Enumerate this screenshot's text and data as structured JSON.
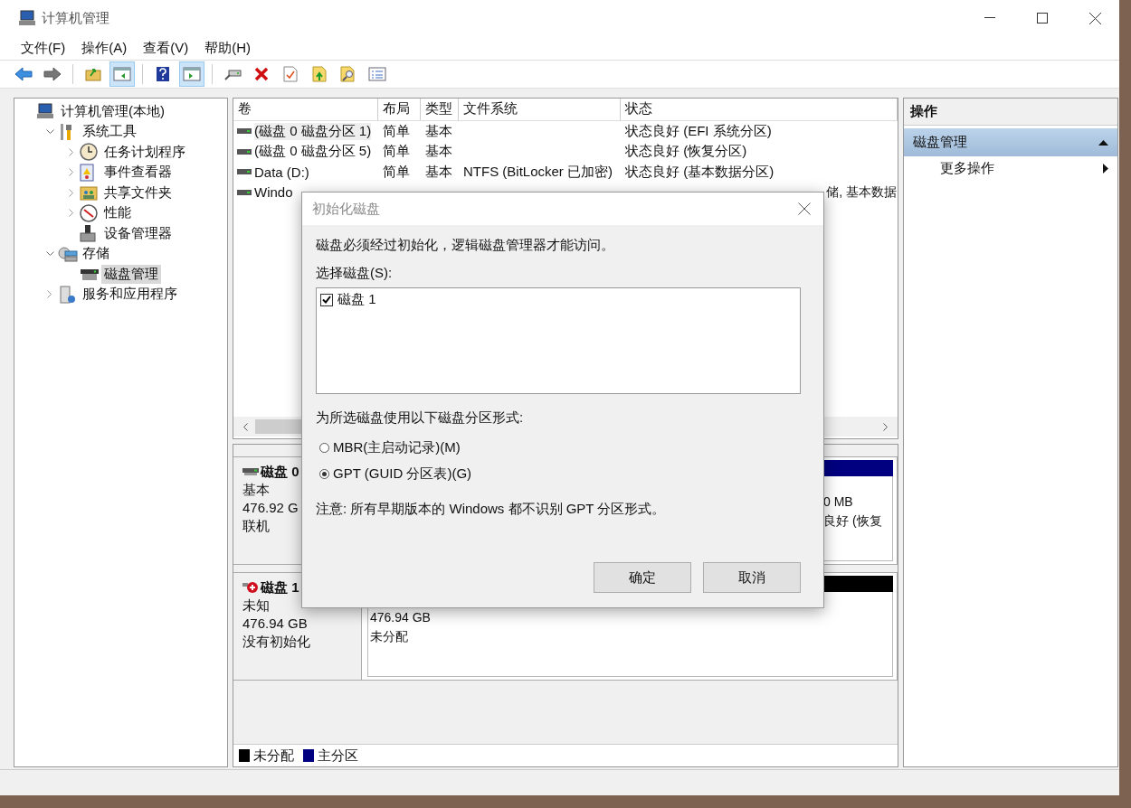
{
  "window": {
    "title": "计算机管理"
  },
  "menu": [
    "文件(F)",
    "操作(A)",
    "查看(V)",
    "帮助(H)"
  ],
  "toolbar": [
    [
      {
        "on": false
      },
      {
        "on": false
      }
    ],
    [
      {
        "on": false
      },
      {
        "on": true
      }
    ],
    [
      {
        "on": false
      },
      {
        "on": true
      }
    ],
    [
      {
        "on": false
      },
      {
        "on": false
      },
      {
        "on": false
      },
      {
        "on": false
      },
      {
        "on": false
      },
      {
        "on": false
      }
    ]
  ],
  "tree": [
    {
      "label": "计算机管理(本地)",
      "selected": false,
      "children": [
        {
          "label": "系统工具",
          "kind": "branch",
          "expanded": true,
          "selected": false,
          "children": [
            {
              "label": "任务计划程序",
              "kind": "branch",
              "expanded": false,
              "selected": false
            },
            {
              "label": "事件查看器",
              "kind": "branch",
              "expanded": false,
              "selected": false
            },
            {
              "label": "共享文件夹",
              "kind": "branch",
              "expanded": false,
              "selected": false
            },
            {
              "label": "性能",
              "kind": "branch",
              "expanded": false,
              "selected": false
            },
            {
              "label": "设备管理器",
              "kind": "leaf",
              "selected": false
            }
          ]
        },
        {
          "label": "存储",
          "kind": "branch",
          "expanded": true,
          "selected": false,
          "children": [
            {
              "label": "磁盘管理",
              "kind": "leaf",
              "selected": true
            }
          ]
        },
        {
          "label": "服务和应用程序",
          "kind": "branch",
          "expanded": false,
          "selected": false
        }
      ]
    }
  ],
  "volumes": {
    "columns": [
      "卷",
      "布局",
      "类型",
      "文件系统",
      "状态"
    ],
    "rows": [
      {
        "volume": "(磁盘 0 磁盘分区 1)",
        "layout": "简单",
        "type": "基本",
        "status": "状态良好 (EFI 系统分区)",
        "selected": true
      },
      {
        "volume": "(磁盘 0 磁盘分区 5)",
        "layout": "简单",
        "type": "基本",
        "status": "状态良好 (恢复分区)",
        "selected": false
      },
      {
        "volume": "Data (D:)",
        "layout": "简单",
        "type": "基本",
        "file_system": "NTFS (BitLocker 已加密)",
        "status": "状态良好 (基本数据分区)",
        "selected": false
      },
      {
        "volume": "Windo",
        "status": "储, 基本数据",
        "selected": false
      }
    ]
  },
  "disks": [
    {
      "name": "磁盘 0",
      "kind": "online",
      "lines": [
        "基本",
        "476.92 G",
        "联机"
      ],
      "partitions": [
        {
          "color": "#000080",
          "lines": [
            "0 MB",
            "良好 (恢复"
          ]
        }
      ]
    },
    {
      "name": "磁盘 1",
      "kind": "error",
      "lines": [
        "未知",
        "476.94 GB",
        "没有初始化"
      ],
      "partitions": [
        {
          "color": "#000000",
          "lines": [
            "476.94 GB",
            "未分配"
          ]
        }
      ]
    }
  ],
  "legend": [
    {
      "label": "未分配",
      "color": "#000000"
    },
    {
      "label": "主分区",
      "color": "#000080"
    }
  ],
  "actions": {
    "title": "操作",
    "items": [
      {
        "label": "磁盘管理",
        "kind": "section",
        "expanded": true
      },
      {
        "label": "更多操作",
        "kind": "submenu"
      }
    ]
  },
  "dialog": {
    "title": "初始化磁盘",
    "message": "磁盘必须经过初始化，逻辑磁盘管理器才能访问。",
    "select_label": "选择磁盘(S):",
    "disks": [
      {
        "label": "磁盘 1",
        "checked": true
      }
    ],
    "style_label": "为所选磁盘使用以下磁盘分区形式:",
    "options": [
      {
        "label": "MBR(主启动记录)(M)",
        "selected": false
      },
      {
        "label": "GPT (GUID 分区表)(G)",
        "selected": true
      }
    ],
    "note": "注意: 所有早期版本的 Windows 都不识别 GPT 分区形式。",
    "buttons": [
      "确定",
      "取消"
    ]
  }
}
